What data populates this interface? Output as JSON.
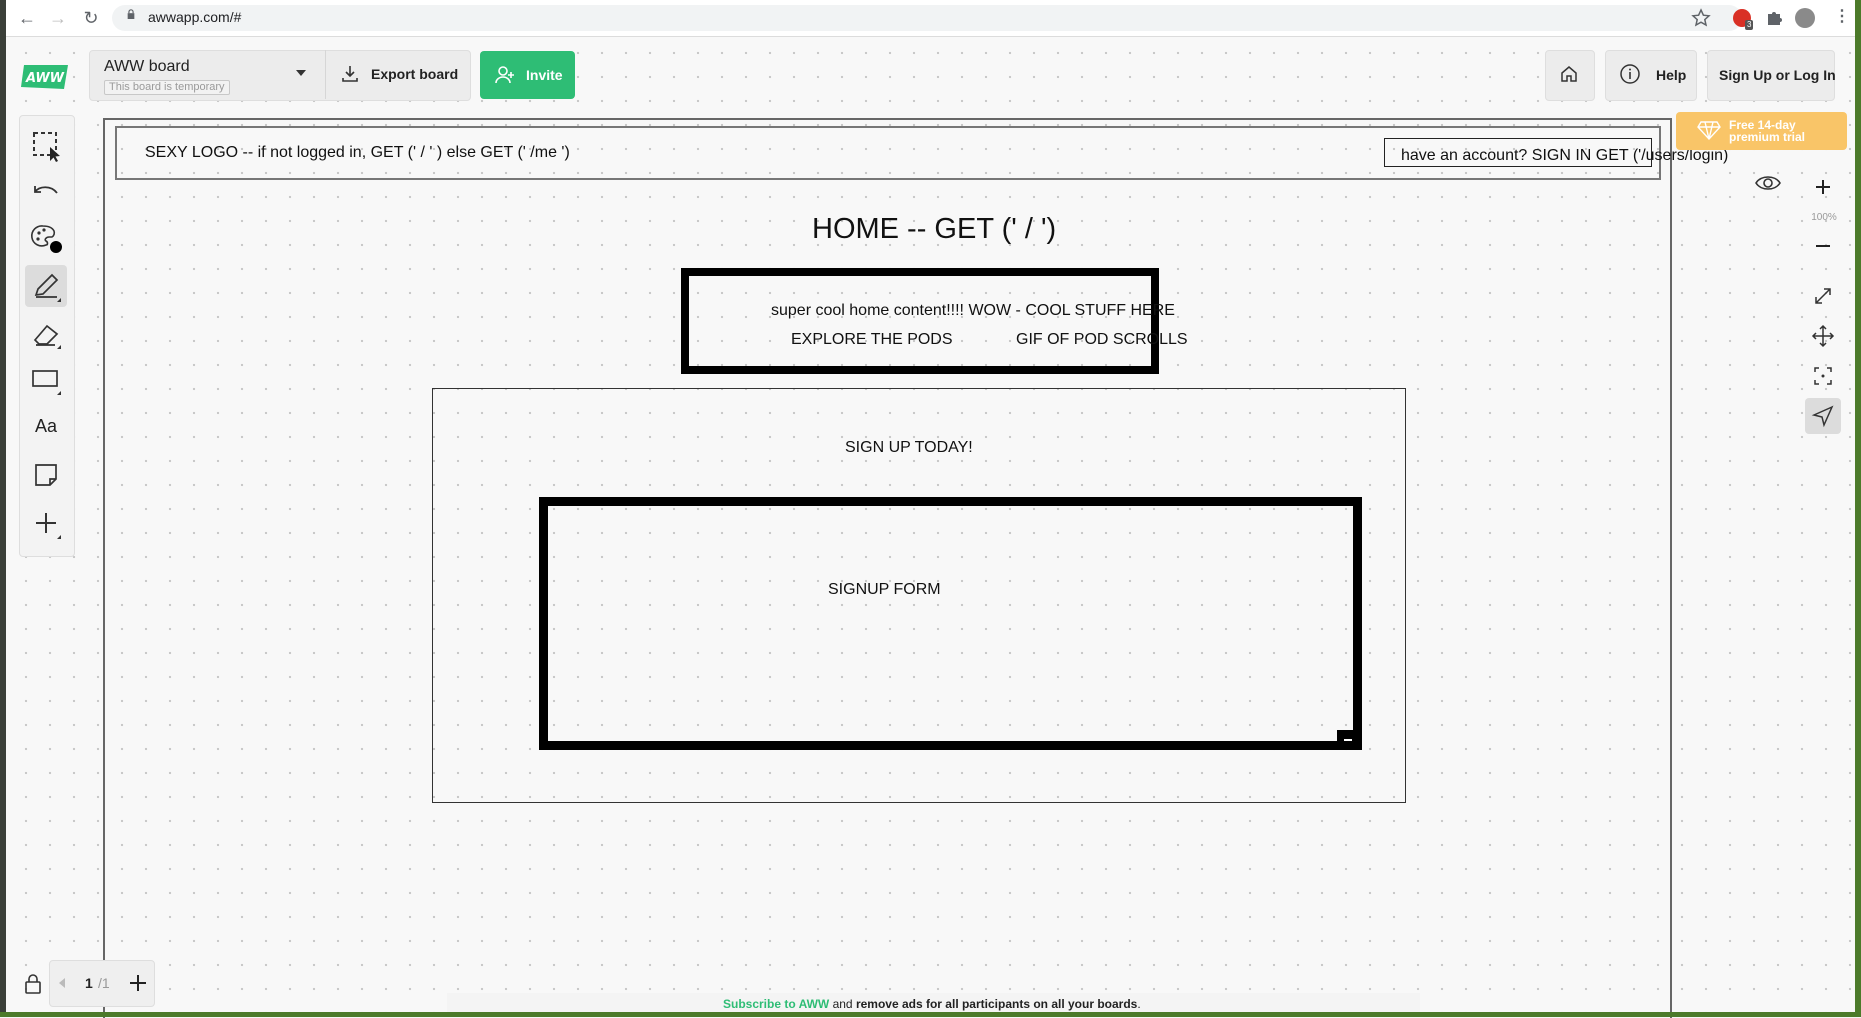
{
  "browser": {
    "url": "awwapp.com/#",
    "extension_badge": "3"
  },
  "app": {
    "logo_text": "AWW",
    "board_title": "AWW board",
    "board_subtitle": "This board is temporary",
    "export_label": "Export board",
    "invite_label": "Invite",
    "help_label": "Help",
    "login_label": "Sign Up or Log In",
    "premium_label": "Free 14-day premium trial",
    "zoom_level": "100%",
    "accent_color": "#2ebd75",
    "premium_color": "#f9c568"
  },
  "toolbar": {
    "tools": [
      {
        "name": "select-icon"
      },
      {
        "name": "undo-icon"
      },
      {
        "name": "palette-icon"
      },
      {
        "name": "pen-icon"
      },
      {
        "name": "eraser-icon"
      },
      {
        "name": "shape-icon"
      },
      {
        "name": "text-tool",
        "label": "Aa"
      },
      {
        "name": "sticky-note-icon"
      },
      {
        "name": "plus-icon"
      }
    ]
  },
  "pager": {
    "current": "1",
    "total": "/1"
  },
  "footer": {
    "subscribe": "Subscribe to AWW",
    "and": " and ",
    "remove": "remove ads for all participants on all your boards",
    "period": "."
  },
  "wireframe": {
    "header_text": "SEXY LOGO -- if not logged in, GET (' / ' ) else GET (' /me ')",
    "login_text": "have an account? SIGN IN GET ('/users/login)",
    "home_title": "HOME -- GET (' / ')",
    "content_line": "super cool home content!!!! WOW - COOL STUFF HERE",
    "explore": "EXPLORE THE PODS",
    "gif": "GIF OF POD SCROLLS",
    "signup_today": "SIGN UP TODAY!",
    "signup_form": "SIGNUP FORM"
  }
}
